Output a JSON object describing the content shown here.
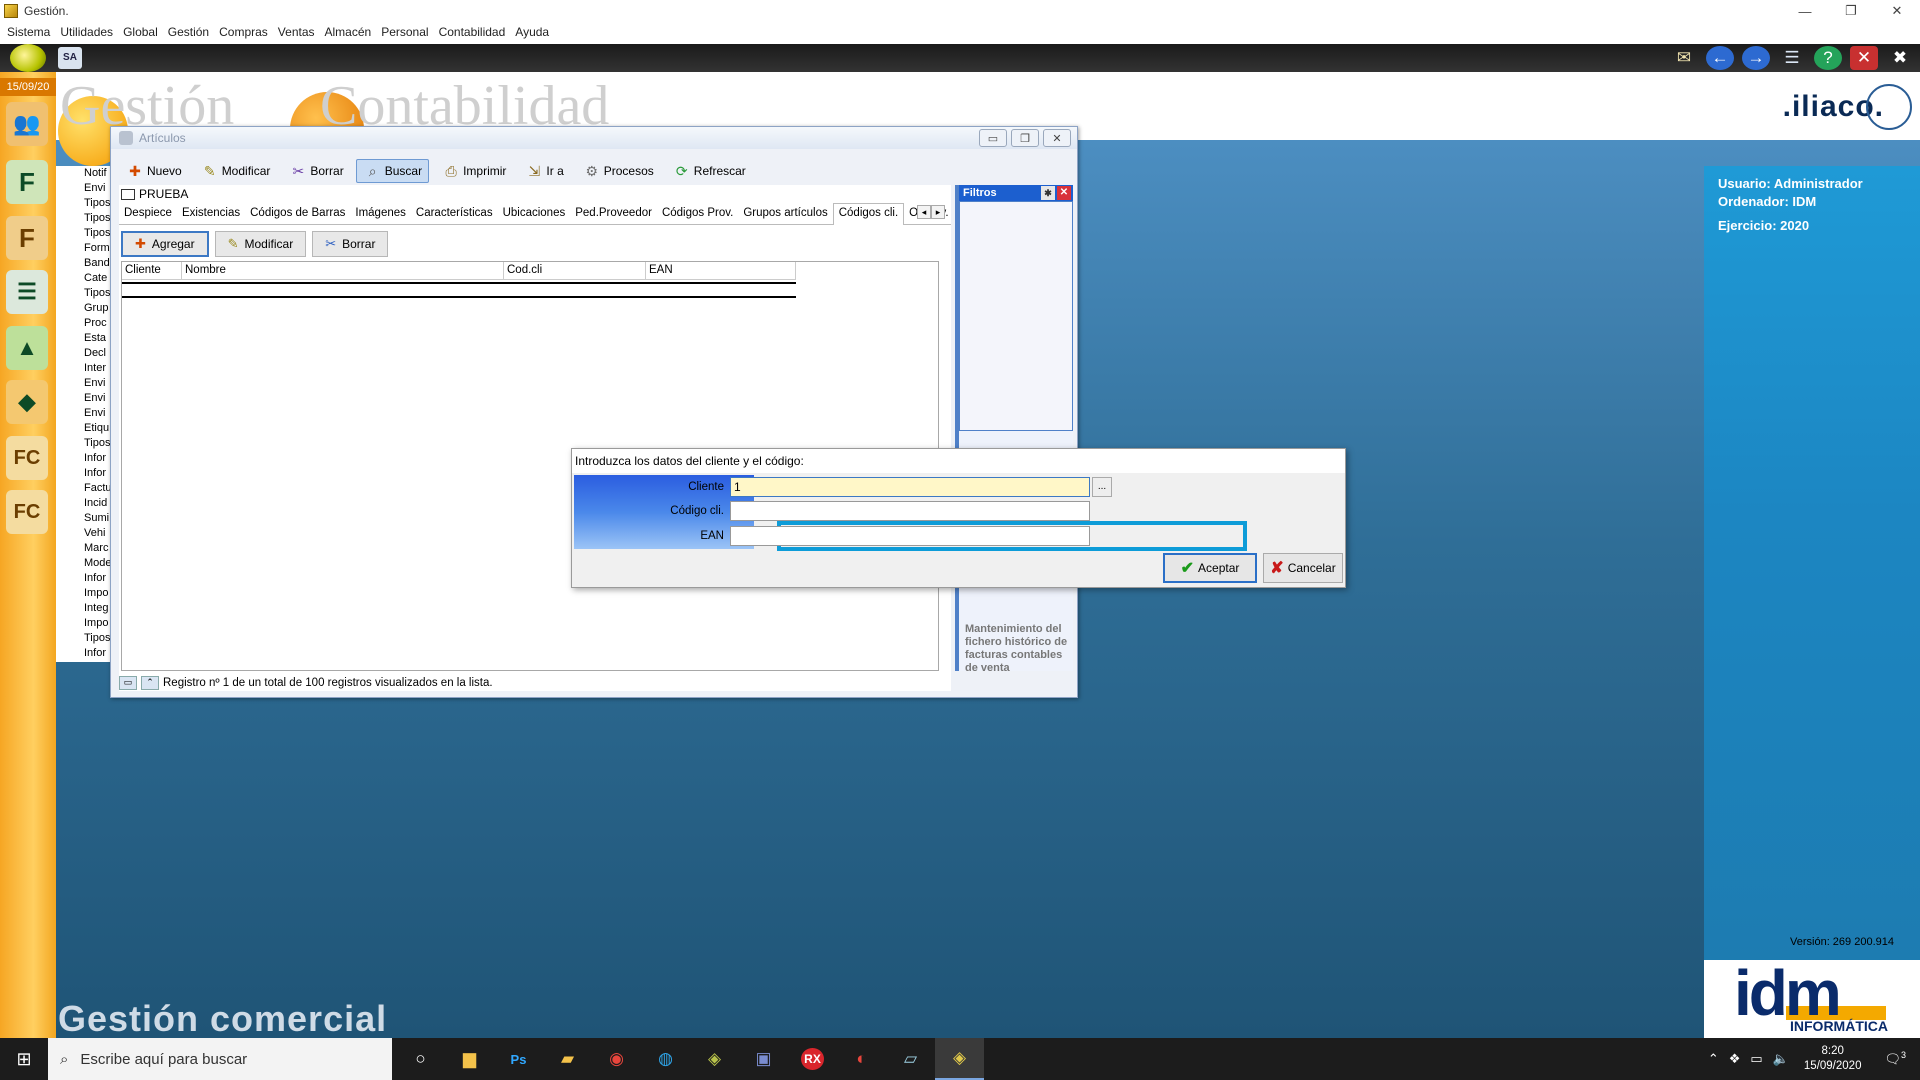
{
  "app": {
    "title": "Gestión.",
    "menu": [
      "Sistema",
      "Utilidades",
      "Global",
      "Gestión",
      "Compras",
      "Ventas",
      "Almacén",
      "Personal",
      "Contabilidad",
      "Ayuda"
    ],
    "date": "15/09/20"
  },
  "desktop": {
    "logo1": "Gestión",
    "logo2": "Contabilidad",
    "brand": ".iliaco.",
    "footer_title": "Gestión comercial",
    "version": "Versión: 269 200.914",
    "idm": "idm",
    "idm_sub": "INFORMÁTICA"
  },
  "left_list": [
    "Notif",
    "Envi",
    "Tipos",
    "Tipos",
    "Tipos",
    "Form",
    "Band",
    "Cate",
    "Tipos",
    "Grup",
    "Proc",
    "Esta",
    "Decl",
    "Inter",
    "Envi",
    "Envi",
    "Envi",
    "Etiqu",
    "Tipos",
    "Infor",
    "Infor",
    "Factu",
    "Incid",
    "Sumi",
    "Vehi",
    "Marc",
    "Mode",
    "Infor",
    "Impo",
    "Integ",
    "Impo",
    "Tipos",
    "Infor"
  ],
  "info_panel": {
    "user": "Usuario: Administrador",
    "ordenador": "Ordenador:  IDM",
    "ejercicio": "Ejercicio: 2020"
  },
  "articulos": {
    "title": "Artículos",
    "toolbar": [
      "Nuevo",
      "Modificar",
      "Borrar",
      "Buscar",
      "Imprimir",
      "Ir a",
      "Procesos",
      "Refrescar"
    ],
    "record": "PRUEBA",
    "tabs": [
      "Despiece",
      "Existencias",
      "Códigos de Barras",
      "Imágenes",
      "Características",
      "Ubicaciones",
      "Ped.Proveedor",
      "Códigos Prov.",
      "Grupos artículos",
      "Códigos cli.",
      "Observ."
    ],
    "active_tab": "Códigos cli.",
    "sub_toolbar": [
      "Agregar",
      "Modificar",
      "Borrar"
    ],
    "columns": [
      "Cliente",
      "Nombre",
      "Cod.cli",
      "EAN"
    ],
    "status": "Registro nº 1 de un total de 100 registros visualizados en la lista."
  },
  "filtros": {
    "title": "Filtros",
    "description": "Mantenimiento del fichero histórico de facturas contables de venta"
  },
  "dialog": {
    "title": "Introduzca los datos del cliente y el código:",
    "fields": {
      "cliente_label": "Cliente",
      "cliente_value": "1",
      "codigo_label": "Código cli.",
      "codigo_value": "",
      "ean_label": "EAN",
      "ean_value": ""
    },
    "accept": "Aceptar",
    "cancel": "Cancelar",
    "dots": "..."
  },
  "taskbar": {
    "search_placeholder": "Escribe aquí para buscar",
    "time": "8:20",
    "date": "15/09/2020",
    "notif_count": "3"
  }
}
